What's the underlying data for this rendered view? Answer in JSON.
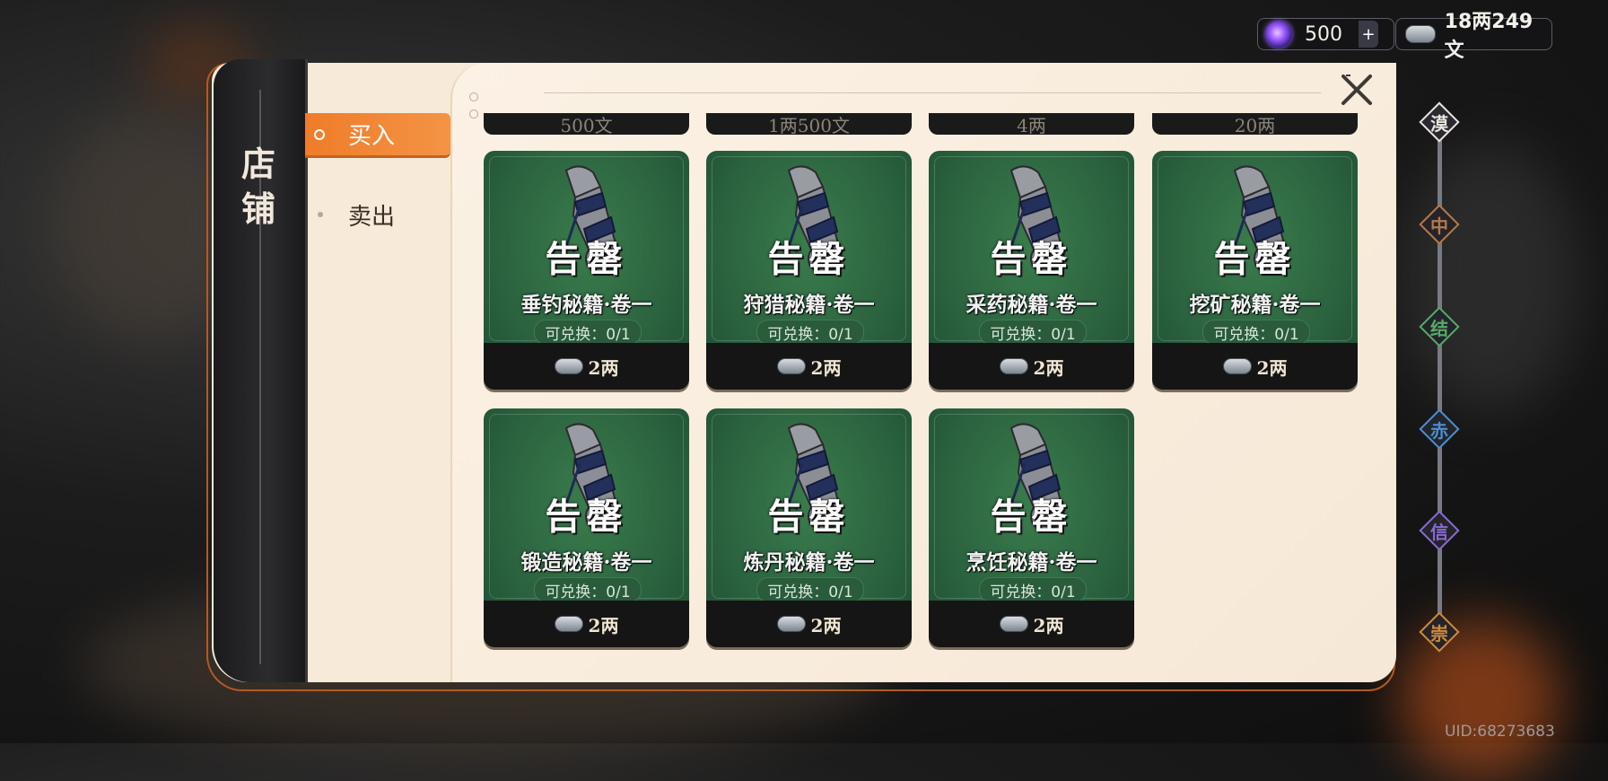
{
  "currency": {
    "gems": "500",
    "gem_add": "+",
    "money": "18两249文"
  },
  "shop": {
    "title_top": "店",
    "title_bottom": "铺",
    "tabs": [
      {
        "label": "买入",
        "active": true
      },
      {
        "label": "卖出",
        "active": false
      }
    ]
  },
  "rail": {
    "nodes": [
      {
        "label": "漠",
        "color": "#e9e4dd"
      },
      {
        "label": "中",
        "color": "#b37a4a"
      },
      {
        "label": "结",
        "color": "#58a96a"
      },
      {
        "label": "赤",
        "color": "#4a8fd1"
      },
      {
        "label": "信",
        "color": "#8a6ad0"
      },
      {
        "label": "崇",
        "color": "#d08a3a"
      }
    ]
  },
  "partial_row": [
    "500文",
    "1两500文",
    "4两",
    "20两"
  ],
  "items": [
    {
      "glyph": "告罄",
      "name": "垂钓秘籍·卷一",
      "limit": "可兑换：0/1",
      "price": "2两"
    },
    {
      "glyph": "告罄",
      "name": "狩猎秘籍·卷一",
      "limit": "可兑换：0/1",
      "price": "2两"
    },
    {
      "glyph": "告罄",
      "name": "采药秘籍·卷一",
      "limit": "可兑换：0/1",
      "price": "2两"
    },
    {
      "glyph": "告罄",
      "name": "挖矿秘籍·卷一",
      "limit": "可兑换：0/1",
      "price": "2两"
    },
    {
      "glyph": "告罄",
      "name": "锻造秘籍·卷一",
      "limit": "可兑换：0/1",
      "price": "2两"
    },
    {
      "glyph": "告罄",
      "name": "炼丹秘籍·卷一",
      "limit": "可兑换：0/1",
      "price": "2两"
    },
    {
      "glyph": "告罄",
      "name": "烹饪秘籍·卷一",
      "limit": "可兑换：0/1",
      "price": "2两"
    }
  ],
  "uid": "UID:68273683",
  "colors": {
    "accent": "#ef7c2a",
    "card_green": "#2c6440"
  }
}
